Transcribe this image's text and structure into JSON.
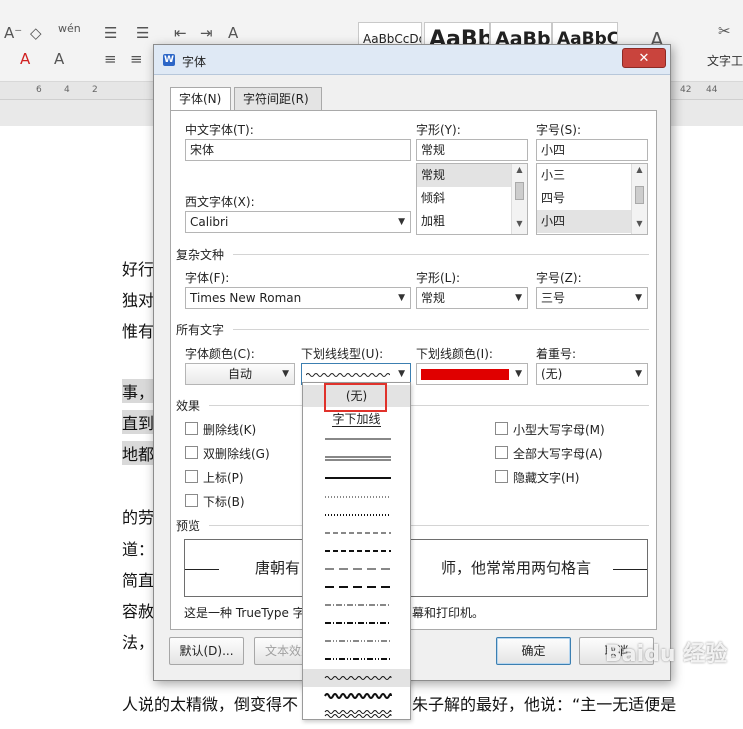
{
  "ribbon": {
    "styles": [
      "AaBbCcDd",
      "AaBb",
      "AaBb(",
      "AaBbC"
    ],
    "right_label": "文字工",
    "ruler_ticks": [
      "6",
      "4",
      "2",
      "42",
      "44"
    ]
  },
  "document": {
    "lines": [
      {
        "text": "好行",
        "shaded": false
      },
      {
        "text": "独对",
        "shaded": false
      },
      {
        "text": "惟有",
        "shaded": false
      },
      {
        "text": "事，",
        "shaded": true
      },
      {
        "text": "直到",
        "shaded": true
      },
      {
        "text": "地都",
        "shaded": true
      },
      {
        "text": "的劳",
        "shaded": false
      },
      {
        "text": "道：",
        "shaded": false
      },
      {
        "text": "简直",
        "shaded": false
      },
      {
        "text": "容赦",
        "shaded": false
      },
      {
        "text": "法，",
        "shaded": false
      }
    ],
    "bottom_line_left": "人说的太精微，倒变得不",
    "bottom_line_right": "朱子解的最好，他说：“主一无适便是"
  },
  "dialog": {
    "title": "字体",
    "close": "✕",
    "tabs": [
      "字体(N)",
      "字符间距(R)"
    ],
    "chinese_font": {
      "label": "中文字体(T):",
      "value": "宋体"
    },
    "western_font": {
      "label": "西文字体(X):",
      "value": "Calibri"
    },
    "style": {
      "label": "字形(Y):",
      "value": "常规",
      "options": [
        "常规",
        "倾斜",
        "加粗"
      ],
      "selected": "常规"
    },
    "size": {
      "label": "字号(S):",
      "value": "小四",
      "options": [
        "小三",
        "四号",
        "小四"
      ],
      "selected": "小四"
    },
    "complex": {
      "section": "复杂文种",
      "font_label": "字体(F):",
      "font_value": "Times New Roman",
      "style_label": "字形(L):",
      "style_value": "常规",
      "size_label": "字号(Z):",
      "size_value": "三号"
    },
    "all_text": {
      "section": "所有文字",
      "color_label": "字体颜色(C):",
      "color_value": "自动",
      "underline_type_label": "下划线线型(U):",
      "underline_color_label": "下划线颜色(I):",
      "underline_color": "#e00000",
      "emphasis_label": "着重号:",
      "emphasis_value": "(无)"
    },
    "effects": {
      "section": "效果",
      "left": [
        "删除线(K)",
        "双删除线(G)",
        "上标(P)",
        "下标(B)"
      ],
      "right": [
        "小型大写字母(M)",
        "全部大写字母(A)",
        "隐藏文字(H)"
      ]
    },
    "preview": {
      "section": "预览",
      "text_left": "唐朝有",
      "text_right": "师，他常常用两句格言",
      "note_left": "这是一种 TrueType 字",
      "note_right": "幕和打印机。"
    },
    "buttons": {
      "default": "默认(D)...",
      "text_effect": "文本效果",
      "ok": "确定",
      "cancel": "取消"
    },
    "underline_dropdown": {
      "none": "(无)",
      "word_only": "字下加线"
    }
  },
  "watermark": "Baidu 经验"
}
